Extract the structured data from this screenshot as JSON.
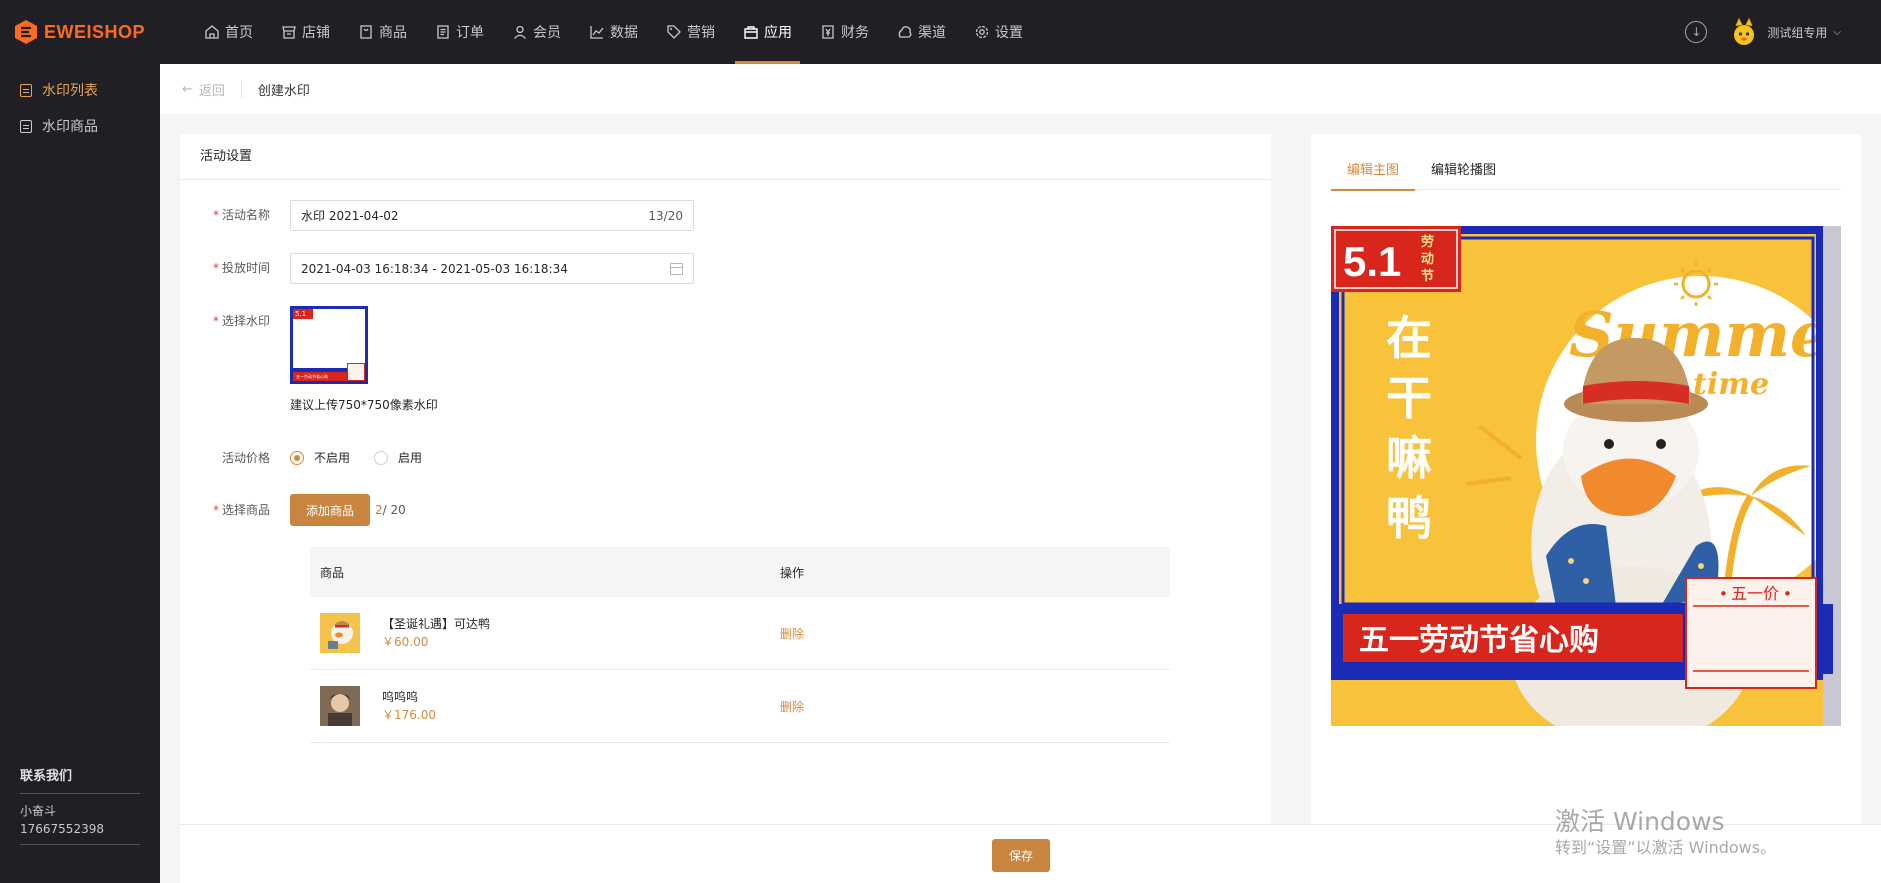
{
  "app": {
    "logo": "EWEISHOP"
  },
  "nav": {
    "items": [
      {
        "label": "首页",
        "icon": "home-icon"
      },
      {
        "label": "店铺",
        "icon": "store-icon"
      },
      {
        "label": "商品",
        "icon": "goods-icon"
      },
      {
        "label": "订单",
        "icon": "order-icon"
      },
      {
        "label": "会员",
        "icon": "member-icon"
      },
      {
        "label": "数据",
        "icon": "chart-icon"
      },
      {
        "label": "营销",
        "icon": "tag-icon"
      },
      {
        "label": "应用",
        "icon": "app-icon",
        "active": true
      },
      {
        "label": "财务",
        "icon": "finance-icon"
      },
      {
        "label": "渠道",
        "icon": "channel-icon"
      },
      {
        "label": "设置",
        "icon": "gear-icon"
      }
    ],
    "user": "测试组专用"
  },
  "sidebar": {
    "items": [
      {
        "label": "水印列表",
        "active": true
      },
      {
        "label": "水印商品"
      }
    ],
    "contact": {
      "title": "联系我们",
      "name": "小奋斗",
      "phone": "17667552398"
    }
  },
  "breadcrumb": {
    "back": "返回",
    "title": "创建水印"
  },
  "form": {
    "card_title": "活动设置",
    "name_label": "活动名称",
    "name_value": "水印 2021-04-02",
    "name_counter": "13/20",
    "time_label": "投放时间",
    "time_value": "2021-04-03 16:18:34 - 2021-05-03 16:18:34",
    "watermark_label": "选择水印",
    "watermark_hint": "建议上传750*750像素水印",
    "price_label": "活动价格",
    "price_options": [
      "不启用",
      "启用"
    ],
    "goods_label": "选择商品",
    "add_goods": "添加商品",
    "goods_count_current": "2",
    "goods_count_max": "/ 20",
    "table": {
      "headers": [
        "商品",
        "操作"
      ],
      "rows": [
        {
          "name": "【圣诞礼遇】可达鸭",
          "price": "￥60.00",
          "action": "删除"
        },
        {
          "name": "呜呜呜",
          "price": "￥176.00",
          "action": "删除"
        }
      ]
    },
    "save": "保存"
  },
  "preview": {
    "tabs": [
      "编辑主图",
      "编辑轮播图"
    ],
    "poster": {
      "badge_num": "5.1",
      "badge_text": [
        "劳",
        "动",
        "节"
      ],
      "vertical_text": [
        "在",
        "干",
        "嘛",
        "鸭"
      ],
      "summer": "Summer",
      "time": "time",
      "banner": "五一劳动节省心购",
      "price_tag": "五一价"
    }
  },
  "watermark": {
    "line1": "激活 Windows",
    "line2": "转到“设置”以激活 Windows。"
  },
  "colors": {
    "accent": "#d38a3c",
    "topbar": "#1f1f24",
    "poster_blue": "#1b2bb5",
    "poster_red": "#d9261c",
    "poster_yellow": "#f8c23a"
  }
}
